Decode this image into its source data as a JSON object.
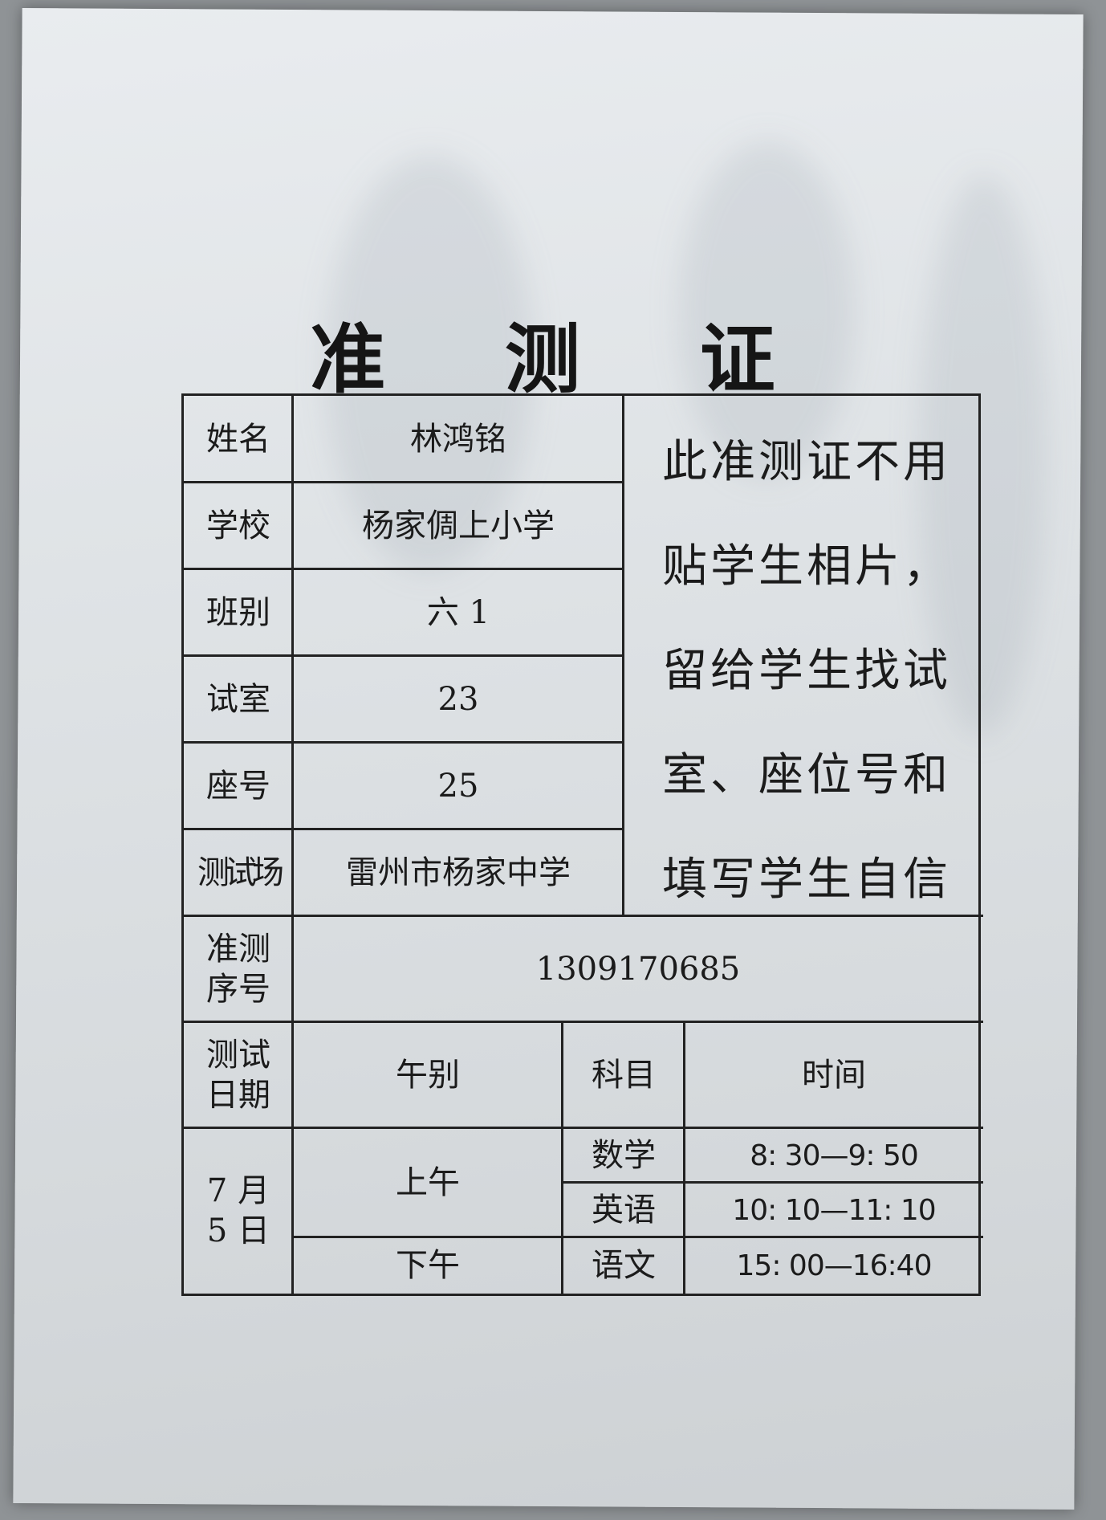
{
  "document": {
    "title": "准 测 证",
    "fields": [
      {
        "label": "姓名",
        "value": "林鸿铭"
      },
      {
        "label": "学校",
        "value": "杨家倜上小学"
      },
      {
        "label": "班别",
        "value": "六 1"
      },
      {
        "label": "试室",
        "value": "23"
      },
      {
        "label": "座号",
        "value": "25"
      },
      {
        "label": "测试场",
        "value": "雷州市杨家中学"
      }
    ],
    "notice": "此准测证不用贴学生相片，留给学生找试室、座位号和填写学生自信",
    "serial": {
      "label": "准测序号",
      "value": "1309170685"
    },
    "schedule_header": {
      "date_label": "测试日期",
      "period_label": "午别",
      "subject_label": "科目",
      "time_label": "时间"
    },
    "schedule": {
      "date": "7 月\n5 日",
      "morning": "上午",
      "afternoon": "下午",
      "rows": [
        {
          "subject": "数学",
          "time": "8: 30—9: 50"
        },
        {
          "subject": "英语",
          "time": "10: 10—11: 10"
        },
        {
          "subject": "语文",
          "time": "15: 00—16:40"
        }
      ]
    }
  }
}
